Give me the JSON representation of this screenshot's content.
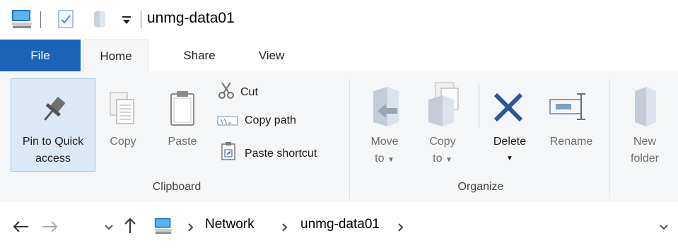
{
  "window": {
    "title": "unmg-data01"
  },
  "tabs": [
    {
      "label": "File"
    },
    {
      "label": "Home"
    },
    {
      "label": "Share"
    },
    {
      "label": "View"
    }
  ],
  "ribbon": {
    "clipboard": {
      "group_label": "Clipboard",
      "pin_line1": "Pin to Quick",
      "pin_line2": "access",
      "copy": "Copy",
      "paste": "Paste",
      "cut": "Cut",
      "copy_path": "Copy path",
      "paste_shortcut": "Paste shortcut"
    },
    "organize": {
      "group_label": "Organize",
      "move_line1": "Move",
      "move_line2": "to",
      "copy_line1": "Copy",
      "copy_line2": "to",
      "delete": "Delete",
      "rename": "Rename"
    },
    "new": {
      "new_line1": "New",
      "new_line2": "folder"
    }
  },
  "address": {
    "crumbs": [
      "Network",
      "unmg-data01"
    ]
  },
  "colors": {
    "file_tab": "#1a63b8",
    "ribbon_bg": "#f5f6f7",
    "selected_bg": "#dbe9f7",
    "delete_x": "#2b5797"
  }
}
